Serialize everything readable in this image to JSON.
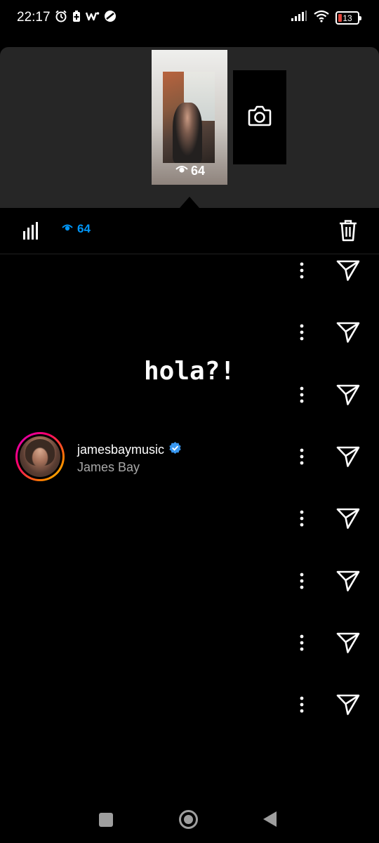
{
  "status_bar": {
    "time": "22:17",
    "battery_level": "13",
    "icons_left": [
      "alarm-icon",
      "battery-saver-icon",
      "app-notification-icon",
      "do-not-disturb-icon"
    ],
    "icons_right": [
      "signal-icon",
      "wifi-icon",
      "battery-icon"
    ]
  },
  "story": {
    "thumbnail_views": "64",
    "camera_label": "camera-icon"
  },
  "stats": {
    "viewers_count": "64",
    "accent_color": "#0095f6"
  },
  "overlay": {
    "text": "hola?!"
  },
  "viewer": {
    "username": "jamesbaymusic",
    "full_name": "James Bay",
    "verified": true
  },
  "viewer_rows": 8,
  "nav": {
    "buttons": [
      "recent-apps",
      "home",
      "back"
    ]
  }
}
